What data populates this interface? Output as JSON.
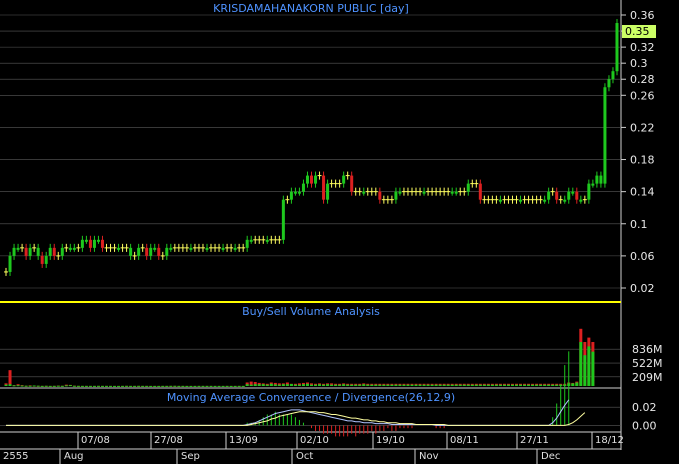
{
  "chart_data": [
    {
      "type": "candlestick",
      "title": "KRISDAMAHANAKORN PUBLIC [day]",
      "last_price": "0.35",
      "y_ticks": [
        "0.36",
        "0.34",
        "0.32",
        "0.3",
        "0.28",
        "0.26",
        "0.22",
        "0.18",
        "0.14",
        "0.1",
        "0.06",
        "0.02"
      ],
      "x_date_labels": [
        "07/08",
        "27/08",
        "13/09",
        "02/10",
        "19/10",
        "08/11",
        "27/11",
        "18/12"
      ],
      "x_month_labels": [
        "2555",
        "Aug",
        "Sep",
        "Oct",
        "Nov",
        "Dec"
      ],
      "closes": [
        0.04,
        0.06,
        0.07,
        0.07,
        0.07,
        0.06,
        0.07,
        0.07,
        0.06,
        0.05,
        0.06,
        0.07,
        0.06,
        0.06,
        0.07,
        0.07,
        0.07,
        0.07,
        0.07,
        0.08,
        0.08,
        0.07,
        0.08,
        0.08,
        0.07,
        0.07,
        0.07,
        0.07,
        0.07,
        0.07,
        0.07,
        0.06,
        0.06,
        0.07,
        0.07,
        0.06,
        0.07,
        0.07,
        0.06,
        0.06,
        0.07,
        0.07,
        0.07,
        0.07,
        0.07,
        0.07,
        0.07,
        0.07,
        0.07,
        0.07,
        0.07,
        0.07,
        0.07,
        0.07,
        0.07,
        0.07,
        0.07,
        0.07,
        0.07,
        0.07,
        0.08,
        0.08,
        0.08,
        0.08,
        0.08,
        0.08,
        0.08,
        0.08,
        0.08,
        0.13,
        0.13,
        0.14,
        0.14,
        0.14,
        0.15,
        0.16,
        0.15,
        0.16,
        0.16,
        0.13,
        0.15,
        0.15,
        0.15,
        0.15,
        0.16,
        0.16,
        0.14,
        0.14,
        0.14,
        0.14,
        0.14,
        0.14,
        0.14,
        0.13,
        0.13,
        0.13,
        0.13,
        0.14,
        0.14,
        0.14,
        0.14,
        0.14,
        0.14,
        0.14,
        0.14,
        0.14,
        0.14,
        0.14,
        0.14,
        0.14,
        0.14,
        0.14,
        0.14,
        0.14,
        0.14,
        0.15,
        0.15,
        0.15,
        0.13,
        0.13,
        0.13,
        0.13,
        0.13,
        0.13,
        0.13,
        0.13,
        0.13,
        0.13,
        0.13,
        0.13,
        0.13,
        0.13,
        0.13,
        0.13,
        0.13,
        0.14,
        0.14,
        0.13,
        0.13,
        0.13,
        0.14,
        0.14,
        0.13,
        0.13,
        0.13,
        0.15,
        0.15,
        0.16,
        0.15,
        0.27,
        0.28,
        0.29,
        0.35
      ],
      "up_days": [
        1,
        3,
        6,
        8,
        16,
        17,
        20,
        23,
        28,
        31,
        33,
        37,
        41,
        46,
        50,
        54,
        57,
        61,
        65,
        69,
        72,
        73,
        75,
        80,
        89,
        98,
        104,
        111,
        112,
        123,
        128,
        134,
        139,
        141,
        143,
        145,
        146,
        147,
        148
      ]
    },
    {
      "type": "bar",
      "title": "Buy/Sell Volume Analysis",
      "y_ticks": [
        "836M",
        "522M",
        "209M"
      ],
      "series": [
        {
          "name": "buy",
          "values": [
            30,
            40,
            15,
            18,
            10,
            8,
            5,
            12,
            7,
            3,
            5,
            3,
            4,
            6,
            4,
            15,
            20,
            5,
            4,
            3,
            3,
            3,
            3,
            4,
            3,
            3,
            3,
            2,
            2,
            3,
            4,
            3,
            3,
            4,
            3,
            3,
            2,
            2,
            2,
            3,
            3,
            4,
            5,
            3,
            3,
            2,
            2,
            2,
            3,
            3,
            3,
            3,
            2,
            2,
            2,
            3,
            2,
            2,
            3,
            2,
            40,
            30,
            40,
            40,
            40,
            30,
            50,
            35,
            30,
            40,
            40,
            45,
            30,
            30,
            40,
            50,
            30,
            30,
            40,
            30,
            40,
            30,
            30,
            30,
            40,
            30,
            30,
            30,
            30,
            40,
            30,
            30,
            30,
            30,
            30,
            30,
            30,
            30,
            30,
            30,
            30,
            30,
            30,
            30,
            30,
            30,
            30,
            30,
            30,
            30,
            30,
            30,
            30,
            30,
            30,
            30,
            30,
            30,
            30,
            30,
            30,
            30,
            30,
            30,
            30,
            30,
            30,
            30,
            30,
            30,
            30,
            30,
            30,
            30,
            30,
            30,
            30,
            30,
            30,
            30,
            60,
            60,
            80,
            1000,
            700,
            900,
            780
          ]
        },
        {
          "name": "sell",
          "values": [
            60,
            360,
            20,
            40,
            20,
            5,
            15,
            8,
            6,
            3,
            4,
            2,
            3,
            10,
            5,
            30,
            25,
            8,
            3,
            2,
            2,
            2,
            2,
            3,
            2,
            2,
            2,
            2,
            2,
            2,
            3,
            2,
            2,
            3,
            2,
            2,
            2,
            2,
            2,
            2,
            2,
            3,
            3,
            2,
            2,
            2,
            2,
            2,
            2,
            2,
            2,
            2,
            2,
            2,
            2,
            2,
            2,
            2,
            2,
            2,
            80,
            100,
            90,
            70,
            60,
            50,
            80,
            70,
            60,
            60,
            80,
            50,
            50,
            60,
            70,
            80,
            60,
            50,
            60,
            50,
            60,
            60,
            50,
            50,
            60,
            50,
            50,
            50,
            50,
            60,
            50,
            50,
            50,
            50,
            50,
            50,
            50,
            50,
            50,
            50,
            50,
            50,
            50,
            50,
            50,
            50,
            50,
            50,
            50,
            50,
            50,
            50,
            50,
            50,
            50,
            50,
            50,
            50,
            50,
            50,
            50,
            50,
            50,
            50,
            50,
            50,
            50,
            50,
            50,
            50,
            50,
            50,
            50,
            50,
            50,
            50,
            50,
            50,
            50,
            50,
            80,
            70,
            100,
            1300,
            1000,
            1100,
            1000
          ]
        }
      ]
    },
    {
      "type": "line",
      "title": "Moving Average Convergence / Divergence(26,12,9)",
      "y_ticks": [
        "0.02",
        "0.00"
      ],
      "series": [
        {
          "name": "MACD",
          "values": [
            0.0,
            0.0,
            0.0,
            0.0,
            0.0,
            0.0,
            0.0,
            0.0,
            0.0,
            0.0,
            0.0,
            0.0,
            0.0,
            0.0,
            0.0,
            0.0,
            0.0,
            0.0,
            0.0,
            0.0,
            0.0,
            0.0,
            0.0,
            0.0,
            0.0,
            0.0,
            0.0,
            0.0,
            0.0,
            0.0,
            0.0,
            0.0,
            0.0,
            0.0,
            0.0,
            0.0,
            0.0,
            0.0,
            0.0,
            0.0,
            0.0,
            0.0,
            0.0,
            0.0,
            0.0,
            0.0,
            0.0,
            0.0,
            0.0,
            0.0,
            0.0,
            0.0,
            0.0,
            0.0,
            0.0,
            0.0,
            0.0,
            0.0,
            0.0,
            0.0,
            0.001,
            0.002,
            0.003,
            0.005,
            0.007,
            0.009,
            0.011,
            0.013,
            0.014,
            0.015,
            0.016,
            0.017,
            0.017,
            0.017,
            0.016,
            0.015,
            0.014,
            0.013,
            0.012,
            0.011,
            0.01,
            0.009,
            0.008,
            0.007,
            0.006,
            0.005,
            0.005,
            0.004,
            0.004,
            0.003,
            0.003,
            0.003,
            0.002,
            0.002,
            0.002,
            0.002,
            0.001,
            0.001,
            0.001,
            0.001,
            0.001,
            0.001,
            0.001,
            0.001,
            0.001,
            0.001,
            0.001,
            0.0,
            0.0,
            0.0,
            0.0,
            0.0,
            0.0,
            0.0,
            0.0,
            0.0,
            0.0,
            0.0,
            0.0,
            0.0,
            0.0,
            0.0,
            0.0,
            0.0,
            0.0,
            0.0,
            0.0,
            0.0,
            0.0,
            0.0,
            0.0,
            0.0,
            0.0,
            0.0,
            0.0,
            0.0,
            0.003,
            0.008,
            0.015,
            0.022,
            0.028
          ]
        },
        {
          "name": "Signal",
          "values": [
            0.0,
            0.0,
            0.0,
            0.0,
            0.0,
            0.0,
            0.0,
            0.0,
            0.0,
            0.0,
            0.0,
            0.0,
            0.0,
            0.0,
            0.0,
            0.0,
            0.0,
            0.0,
            0.0,
            0.0,
            0.0,
            0.0,
            0.0,
            0.0,
            0.0,
            0.0,
            0.0,
            0.0,
            0.0,
            0.0,
            0.0,
            0.0,
            0.0,
            0.0,
            0.0,
            0.0,
            0.0,
            0.0,
            0.0,
            0.0,
            0.0,
            0.0,
            0.0,
            0.0,
            0.0,
            0.0,
            0.0,
            0.0,
            0.0,
            0.0,
            0.0,
            0.0,
            0.0,
            0.0,
            0.0,
            0.0,
            0.0,
            0.0,
            0.0,
            0.0,
            0.0,
            0.001,
            0.002,
            0.003,
            0.004,
            0.005,
            0.007,
            0.008,
            0.01,
            0.011,
            0.012,
            0.013,
            0.014,
            0.015,
            0.015,
            0.015,
            0.015,
            0.015,
            0.014,
            0.014,
            0.013,
            0.012,
            0.012,
            0.011,
            0.01,
            0.009,
            0.008,
            0.008,
            0.007,
            0.006,
            0.006,
            0.005,
            0.005,
            0.004,
            0.004,
            0.003,
            0.003,
            0.003,
            0.002,
            0.002,
            0.002,
            0.002,
            0.001,
            0.001,
            0.001,
            0.001,
            0.001,
            0.001,
            0.001,
            0.001,
            0.0,
            0.0,
            0.0,
            0.0,
            0.0,
            0.0,
            0.0,
            0.0,
            0.0,
            0.0,
            0.0,
            0.0,
            0.0,
            0.0,
            0.0,
            0.0,
            0.0,
            0.0,
            0.0,
            0.0,
            0.0,
            0.0,
            0.0,
            0.0,
            0.0,
            0.0,
            0.0,
            0.0,
            0.0,
            0.0,
            0.001,
            0.003,
            0.006,
            0.01,
            0.014
          ]
        }
      ]
    }
  ],
  "colors": {
    "up": "#1ec81e",
    "down": "#dc2020",
    "flat": "#ffff60",
    "grid": "#5a5a5a",
    "divider": "#ffff00",
    "title": "#4f93ff",
    "last_price_box": "#ccff66",
    "macd": "#b0c4ff",
    "signal": "#ffffa0"
  }
}
